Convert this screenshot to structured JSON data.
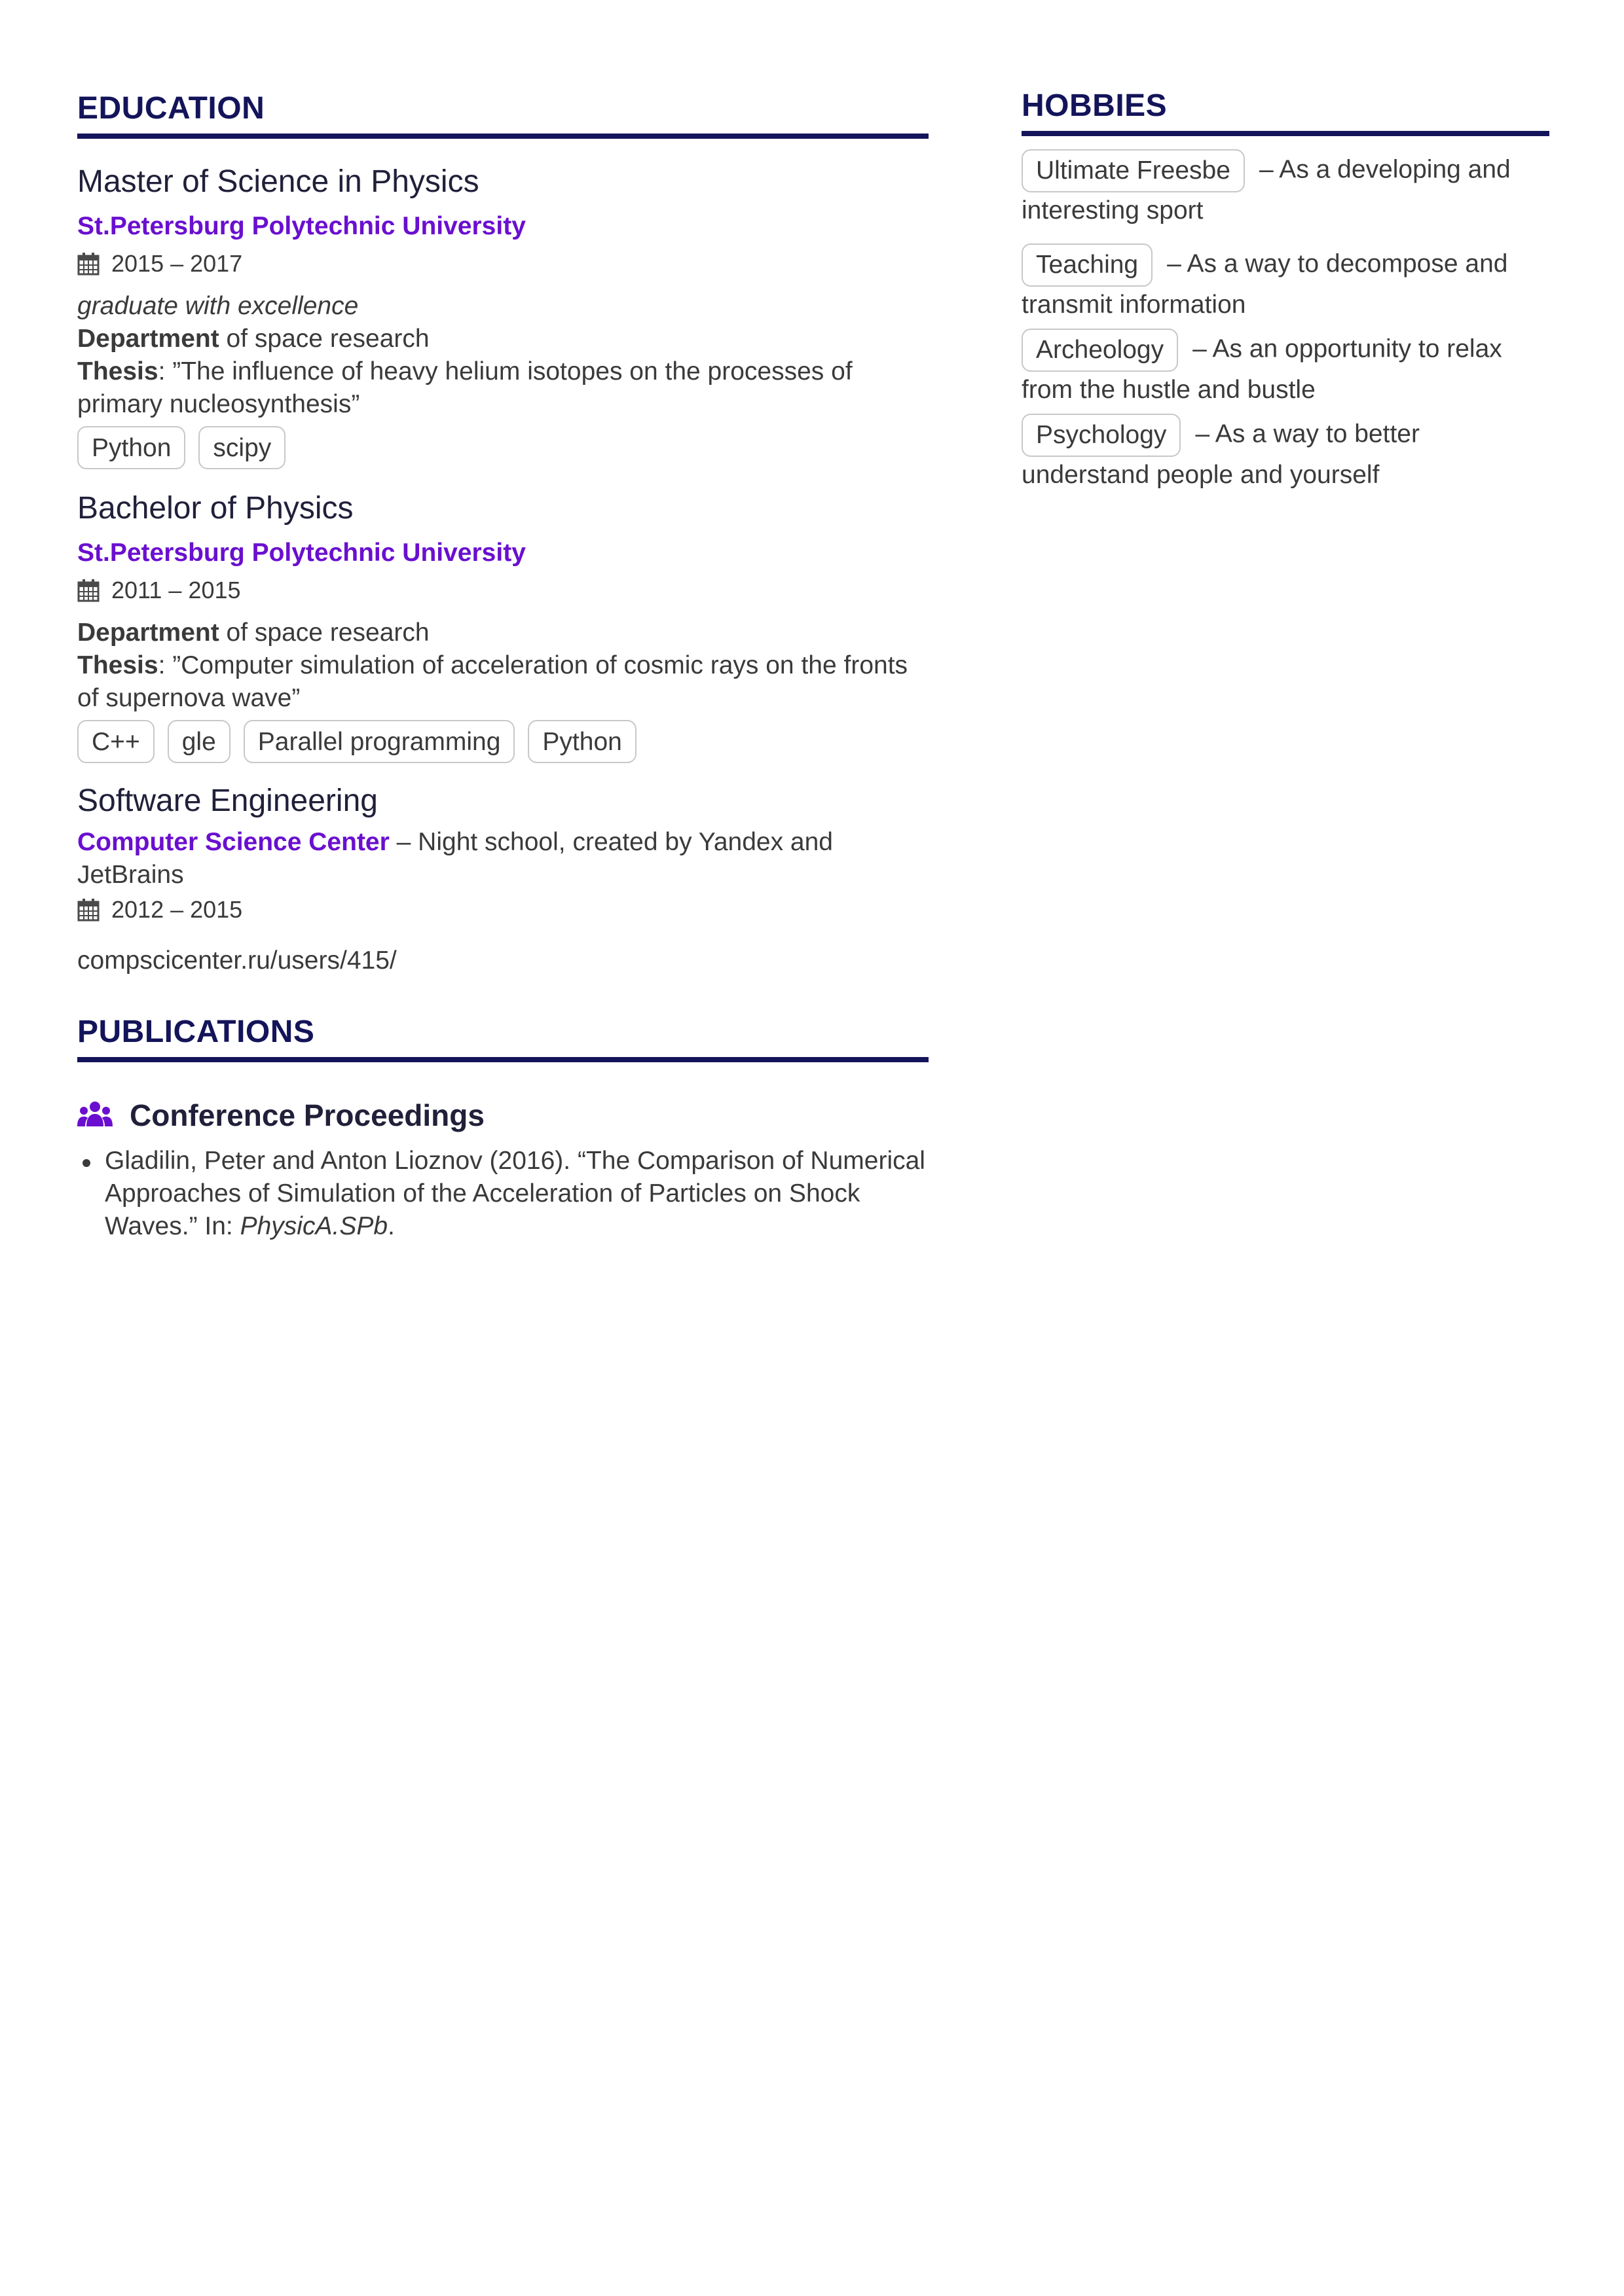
{
  "education": {
    "title": "EDUCATION",
    "entries": [
      {
        "degree": "Master of Science in Physics",
        "school": "St.Petersburg Polytechnic University",
        "dates": "2015 – 2017",
        "note": "graduate with excellence",
        "department_label": "Department",
        "department_text": " of space research",
        "thesis_label": "Thesis",
        "thesis_text": ": ”The influence of heavy helium isotopes on the processes of primary nucleosynthesis”",
        "tags": [
          "Python",
          "scipy"
        ]
      },
      {
        "degree": "Bachelor of Physics",
        "school": "St.Petersburg Polytechnic University",
        "dates": "2011 – 2015",
        "department_label": "Department",
        "department_text": " of space research",
        "thesis_label": "Thesis",
        "thesis_text": ": ”Computer simulation of acceleration of cosmic rays on the fronts of supernova wave”",
        "tags": [
          "C++",
          "gle",
          "Parallel programming",
          "Python"
        ]
      },
      {
        "degree": "Software Engineering",
        "school": "Computer Science Center",
        "school_suffix": " – Night school, created by Yandex and JetBrains",
        "dates": "2012 – 2015",
        "url": "compscicenter.ru/users/415/"
      }
    ]
  },
  "publications": {
    "title": "PUBLICATIONS",
    "group_title": "Conference Proceedings",
    "group_icon": "users-icon",
    "items": [
      {
        "text": "Gladilin, Peter and Anton Lioznov (2016). “The Comparison of Numerical Approaches of Simulation of the Acceleration of Particles on Shock Waves.” In: ",
        "venue": "PhysicA.SPb",
        "end": "."
      }
    ]
  },
  "hobbies": {
    "title": "HOBBIES",
    "items": [
      {
        "name": "Ultimate Freesbe",
        "desc": "– As a developing and interesting sport"
      },
      {
        "name": "Teaching",
        "desc": "– As a way to decompose and transmit information"
      },
      {
        "name": "Archeology",
        "desc": "– As an opportunity to relax from the hustle and bustle"
      },
      {
        "name": "Psychology",
        "desc": "– As a way to better understand people and yourself"
      }
    ]
  },
  "colors": {
    "heading": "#14145a",
    "accent": "#6a0fcf",
    "text": "#3a3a3a"
  }
}
